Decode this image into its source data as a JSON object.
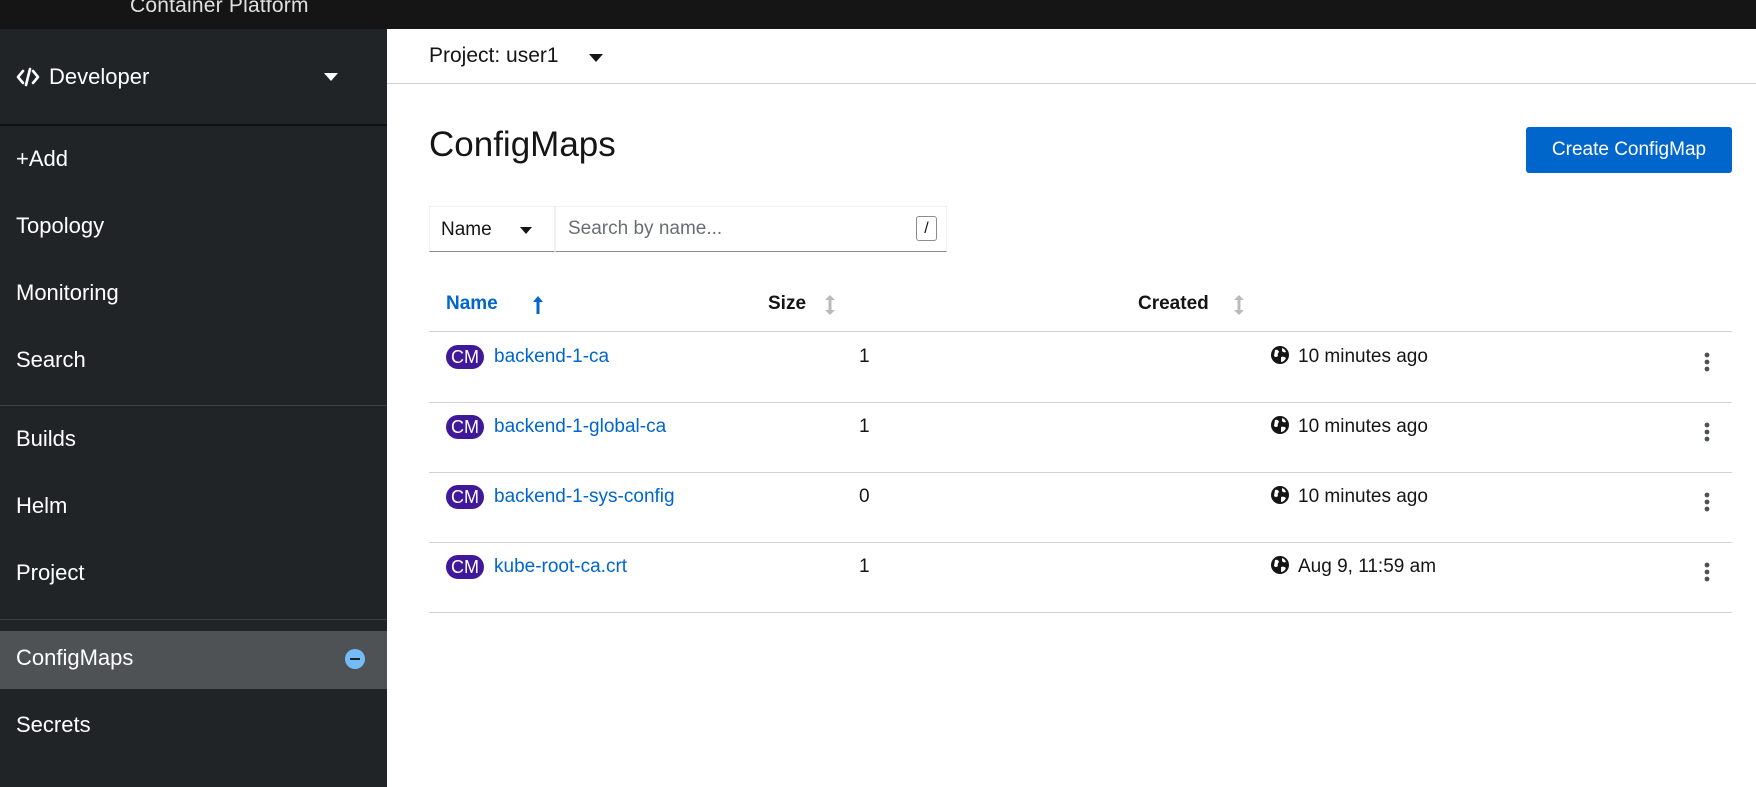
{
  "masthead": {
    "brand": "Container Platform"
  },
  "sidebar": {
    "perspective": {
      "label": "Developer",
      "icon": "code-icon"
    },
    "items": [
      {
        "label": "+Add"
      },
      {
        "label": "Topology"
      },
      {
        "label": "Monitoring"
      },
      {
        "label": "Search"
      },
      {
        "label": "Builds"
      },
      {
        "label": "Helm"
      },
      {
        "label": "Project"
      },
      {
        "label": "ConfigMaps",
        "active": true,
        "icon": "minus-circle-icon"
      },
      {
        "label": "Secrets"
      }
    ]
  },
  "project_bar": {
    "label": "Project: user1"
  },
  "main": {
    "title": "ConfigMaps",
    "create_button": "Create ConfigMap",
    "filter": {
      "type": "Name",
      "placeholder": "Search by name...",
      "shortcut": "/"
    },
    "columns": [
      {
        "label": "Name",
        "sort": "ascending"
      },
      {
        "label": "Size",
        "sort": "none"
      },
      {
        "label": "Created",
        "sort": "none"
      }
    ],
    "rows": [
      {
        "badge": "CM",
        "name": "backend-1-ca",
        "size": "1",
        "created": "10 minutes ago"
      },
      {
        "badge": "CM",
        "name": "backend-1-global-ca",
        "size": "1",
        "created": "10 minutes ago"
      },
      {
        "badge": "CM",
        "name": "backend-1-sys-config",
        "size": "0",
        "created": "10 minutes ago"
      },
      {
        "badge": "CM",
        "name": "kube-root-ca.crt",
        "size": "1",
        "created": "Aug 9, 11:59 am"
      }
    ]
  },
  "colors": {
    "accent": "#0066cc",
    "badge": "#40199a",
    "sidebar": "#212427",
    "active_nav": "#4f5255"
  }
}
